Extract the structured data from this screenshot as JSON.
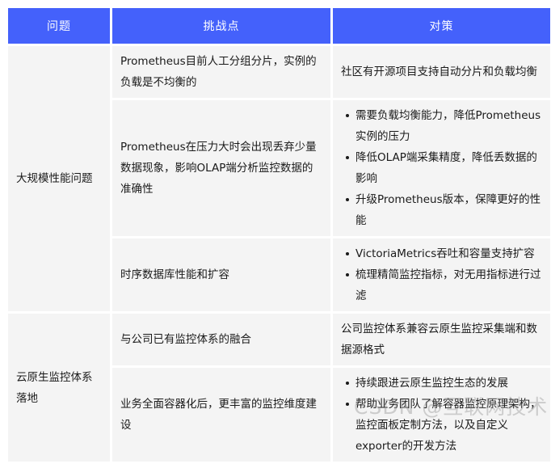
{
  "table": {
    "headers": [
      {
        "label": "问题"
      },
      {
        "label": "挑战点"
      },
      {
        "label": "对策"
      }
    ],
    "groups": [
      {
        "problem": "大规模性能问题",
        "rows": [
          {
            "pain": "Prometheus目前人工分组分片，实例的负载是不均衡的",
            "action_type": "text",
            "action_text": "社区有开源项目支持自动分片和负载均衡",
            "action_items": []
          },
          {
            "pain": "Prometheus在压力大时会出现丢弃少量数据现象，影响OLAP端分析监控数据的准确性",
            "action_type": "list",
            "action_text": "",
            "action_items": [
              "需要负载均衡能力，降低Prometheus实例的压力",
              "降低OLAP端采集精度，降低丢数据的影响",
              "升级Prometheus版本，保障更好的性能"
            ]
          },
          {
            "pain": "时序数据库性能和扩容",
            "action_type": "list",
            "action_text": "",
            "action_items": [
              "VictoriaMetrics吞吐和容量支持扩容",
              "梳理精简监控指标，对无用指标进行过滤"
            ]
          }
        ]
      },
      {
        "problem": "云原生监控体系落地",
        "rows": [
          {
            "pain": "与公司已有监控体系的融合",
            "action_type": "text",
            "action_text": "公司监控体系兼容云原生监控采集端和数据源格式",
            "action_items": []
          },
          {
            "pain": "业务全面容器化后，更丰富的监控维度建设",
            "action_type": "list",
            "action_text": "",
            "action_items": [
              "持续跟进云原生监控生态的发展",
              "帮助业务团队了解容器监控原理架构，监控面板定制方法，以及自定义exporter的开发方法"
            ]
          }
        ]
      }
    ]
  },
  "watermark": {
    "text": "CSDN @互联网技术"
  },
  "colors": {
    "header_bg": "#4461fb",
    "header_text": "#ffffff",
    "cell_bg": "#f4f4f4",
    "cell_text": "#1a1a1a",
    "page_bg": "#ffffff"
  }
}
